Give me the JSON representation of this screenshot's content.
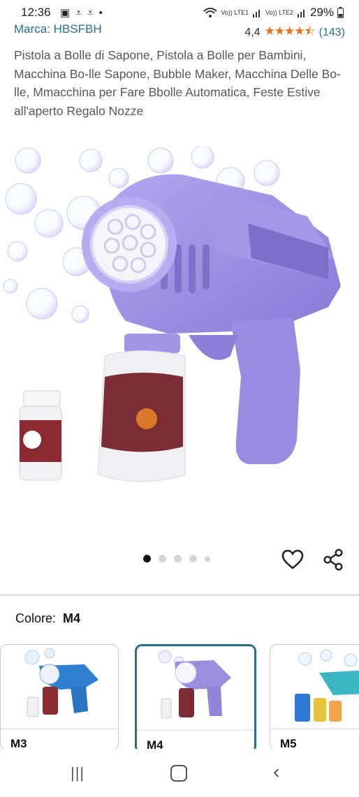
{
  "status": {
    "time": "12:36",
    "left_icons": "▣ ⩡ ⩡ •",
    "carrier1": "Vo)) LTE1",
    "carrier2": "Vo)) LTE2",
    "battery": "29%"
  },
  "brand": {
    "label": "Marca: HBSFBH"
  },
  "rating": {
    "value": "4,4",
    "stars": "★★★★⯪",
    "count": "(143)"
  },
  "product": {
    "title": "Pistola a Bolle di Sapone, Pistola a Bolle per Bambini, Macchina Bo-lle Sapone, Bubble Maker, Macchina Delle Bo-lle, Mmacchina per Fare Bbolle Automatica, Feste Estive all'aperto Regalo Nozze"
  },
  "gallery": {
    "image_count": 5,
    "active_index": 0
  },
  "color_selector": {
    "label": "Colore:",
    "selected": "M4",
    "variants": [
      {
        "name": "M3",
        "color": "#2f80d0"
      },
      {
        "name": "M4",
        "color": "#9b8de0"
      },
      {
        "name": "M5",
        "color": "#3bb7c4"
      }
    ]
  },
  "nav": {
    "recents": "|||",
    "back": "‹"
  },
  "colors": {
    "link": "#2a6f86",
    "star": "#e7711b",
    "selected_border": "#2a6f86"
  }
}
